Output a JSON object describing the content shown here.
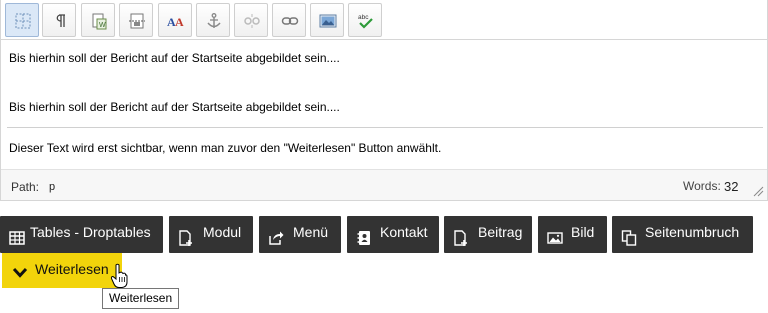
{
  "editor": {
    "toolbar": {
      "buttons": [
        {
          "icon": "show-blocks-icon",
          "active": true
        },
        {
          "icon": "paragraph-marks-icon"
        },
        {
          "icon": "paste-from-word-icon"
        },
        {
          "icon": "page-break-icon"
        },
        {
          "icon": "text-color-icon"
        },
        {
          "icon": "anchor-icon"
        },
        {
          "icon": "unlink-icon"
        },
        {
          "icon": "link-icon"
        },
        {
          "icon": "image-icon"
        },
        {
          "icon": "spellcheck-icon",
          "text": "abc"
        }
      ]
    },
    "content": {
      "paragraph_1": "Bis hierhin soll der Bericht auf der Startseite abgebildet sein....",
      "paragraph_2": "Bis hierhin soll der Bericht auf der Startseite abgebildet sein....",
      "paragraph_3": "Dieser Text wird erst sichtbar, wenn man zuvor den \"Weiterlesen\" Button anwählt."
    },
    "status": {
      "path_label": "Path:",
      "path_value": "p",
      "words_label": "Words:",
      "words_count": "32"
    }
  },
  "actions": {
    "tables": {
      "label": "Tables - Droptables",
      "icon": "table-icon"
    },
    "modul": {
      "label": "Modul",
      "icon": "document-add-icon"
    },
    "menu": {
      "label": "Menü",
      "icon": "share-icon"
    },
    "kontakt": {
      "label": "Kontakt",
      "icon": "contact-card-icon"
    },
    "beitrag": {
      "label": "Beitrag",
      "icon": "document-add-icon"
    },
    "bild": {
      "label": "Bild",
      "icon": "picture-icon"
    },
    "seitenumbruch": {
      "label": "Seitenumbruch",
      "icon": "copy-document-icon"
    },
    "weiterlesen": {
      "label": "Weiterlesen",
      "icon": "chevron-down-icon"
    }
  },
  "tooltip": {
    "text": "Weiterlesen"
  },
  "colors": {
    "button_dark": "#333333",
    "readmore_yellow": "#f2d40b",
    "active_toolbar": "#dbe8f7"
  }
}
